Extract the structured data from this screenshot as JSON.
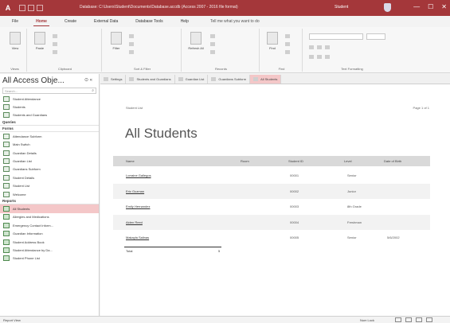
{
  "titlebar": {
    "app_letter": "A",
    "title": "Database: C:\\Users\\Student\\Documents\\Database.accdb (Access 2007 - 2016 file format)",
    "user": "Student",
    "minimize": "—",
    "maximize": "☐",
    "close": "✕"
  },
  "ribbon_tabs": [
    "File",
    "Home",
    "Create",
    "External Data",
    "Database Tools",
    "Help"
  ],
  "ribbon_tellme": "Tell me what you want to do",
  "ribbon_groups": {
    "views": "Views",
    "clipboard": "Clipboard",
    "sort_filter": "Sort & Filter",
    "records": "Records",
    "find": "Find",
    "text_formatting": "Text Formatting"
  },
  "ribbon_buttons": {
    "view": "View",
    "paste": "Paste",
    "filter": "Filter",
    "refresh_all": "Refresh All",
    "find": "Find"
  },
  "nav": {
    "title": "All Access Obje...",
    "search_placeholder": "Search...",
    "items": [
      {
        "label": "Student Attendance",
        "type": "table"
      },
      {
        "label": "Students",
        "type": "table"
      },
      {
        "label": "Students and Guardians",
        "type": "table"
      }
    ],
    "queries_label": "Queries",
    "forms_label": "Forms",
    "forms": [
      "Attendance Subform",
      "Main Switch",
      "Guardian Details",
      "Guardian List",
      "Guardians Subform",
      "Student Details",
      "Student List",
      "Welcome"
    ],
    "reports_label": "Reports",
    "reports": [
      {
        "label": "All Students",
        "selected": true
      },
      {
        "label": "Allergies and Medications",
        "selected": false
      },
      {
        "label": "Emergency Contact Inform...",
        "selected": false
      },
      {
        "label": "Guardian Information",
        "selected": false
      },
      {
        "label": "Student Address Book",
        "selected": false
      },
      {
        "label": "Student Attendance by Da...",
        "selected": false
      },
      {
        "label": "Student Phone List",
        "selected": false
      }
    ]
  },
  "doc_tabs": [
    {
      "label": "Settings",
      "active": false
    },
    {
      "label": "Students and Guardians",
      "active": false
    },
    {
      "label": "Guardian List",
      "active": false
    },
    {
      "label": "Guardians Subform",
      "active": false
    },
    {
      "label": "All Students",
      "active": true
    }
  ],
  "report": {
    "subtitle": "Student List",
    "page": "Page 1 of 1",
    "title": "All Students",
    "columns": [
      "Name",
      "Room",
      "Student ID",
      "Level",
      "Date of Birth"
    ],
    "rows": [
      [
        "Lorraine Gallegos",
        "",
        "00001",
        "Senior",
        ""
      ],
      [
        "Eric Guzman",
        "",
        "00002",
        "Junior",
        ""
      ],
      [
        "Emily Hernandez",
        "",
        "00003",
        "8th Grade",
        ""
      ],
      [
        "Aiden Reed",
        "",
        "00004",
        "Freshman",
        ""
      ],
      [
        "Makayla Salinas",
        "",
        "00005",
        "Senior",
        "5/6/2002"
      ]
    ],
    "total_label": "Total",
    "total_value": "5"
  },
  "status": {
    "ready": "Report View",
    "numlock": "Num Lock"
  },
  "colors": {
    "accent": "#a4373a",
    "selected": "#f4c7c8"
  }
}
